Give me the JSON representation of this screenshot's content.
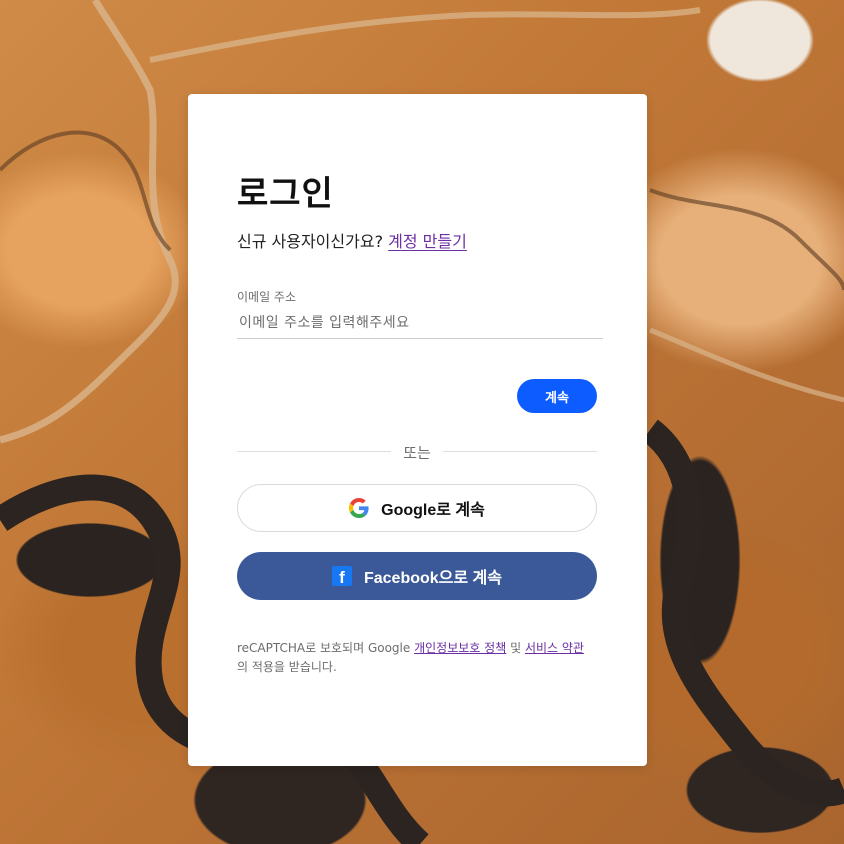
{
  "background": {
    "description_icon": "aerial-landscape-background"
  },
  "login": {
    "title": "로그인",
    "signup_prompt": "신규 사용자이신가요?",
    "signup_link": "계정 만들기",
    "email_label": "이메일 주소",
    "email_value": "",
    "email_placeholder": "이메일 주소를 입력해주세요",
    "continue_label": "계속",
    "divider_text": "또는",
    "google_label": "Google로 계속",
    "facebook_label": "Facebook으로 계속",
    "legal": {
      "prefix": "reCAPTCHA로 보호되며 Google",
      "privacy_link": "개인정보보호 정책",
      "and": "및",
      "terms_link": "서비스 약관",
      "suffix": "의 적용을 받습니다."
    }
  },
  "colors": {
    "primary_button": "#0d5cff",
    "facebook_button": "#3b5998",
    "link": "#6b2fa3"
  }
}
